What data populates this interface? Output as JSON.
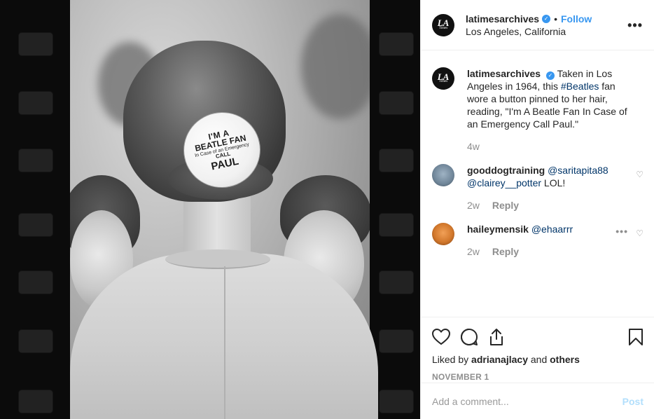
{
  "colors": {
    "link_blue": "#3897f0",
    "muted": "#8e8e8e",
    "text": "#262626",
    "border": "#efefef"
  },
  "photo": {
    "button_text": [
      "I'M A",
      "BEATLE FAN",
      "In Case of an Emergency",
      "CALL",
      "PAUL"
    ]
  },
  "header": {
    "username": "latimesarchives",
    "follow_label": "Follow",
    "separator": "•",
    "location": "Los Angeles, California",
    "more_icon": "more-horizontal-icon",
    "avatar_text": "LA",
    "avatar_subtext": "Times"
  },
  "caption": {
    "username": "latimesarchives",
    "text_before": "Taken in Los Angeles in 1964, this ",
    "hashtag": "#Beatles",
    "text_after": " fan wore a button pinned to her hair, reading, \"I'm A Beatle Fan In Case of an Emergency Call Paul.\"",
    "time": "4w"
  },
  "comments": [
    {
      "username": "gooddogtraining",
      "mention1": "@saritapita88",
      "mention2": "@clairey__potter",
      "text": " LOL!",
      "time": "2w",
      "reply_label": "Reply"
    },
    {
      "username": "haileymensik",
      "mention1": "@ehaarrr",
      "time": "2w",
      "reply_label": "Reply"
    }
  ],
  "actions": {
    "likes_prefix": "Liked by ",
    "liked_user": "adrianajlacy",
    "likes_middle": " and ",
    "likes_others": "others",
    "date": "NOVEMBER 1"
  },
  "add_comment": {
    "placeholder": "Add a comment...",
    "post_label": "Post"
  }
}
